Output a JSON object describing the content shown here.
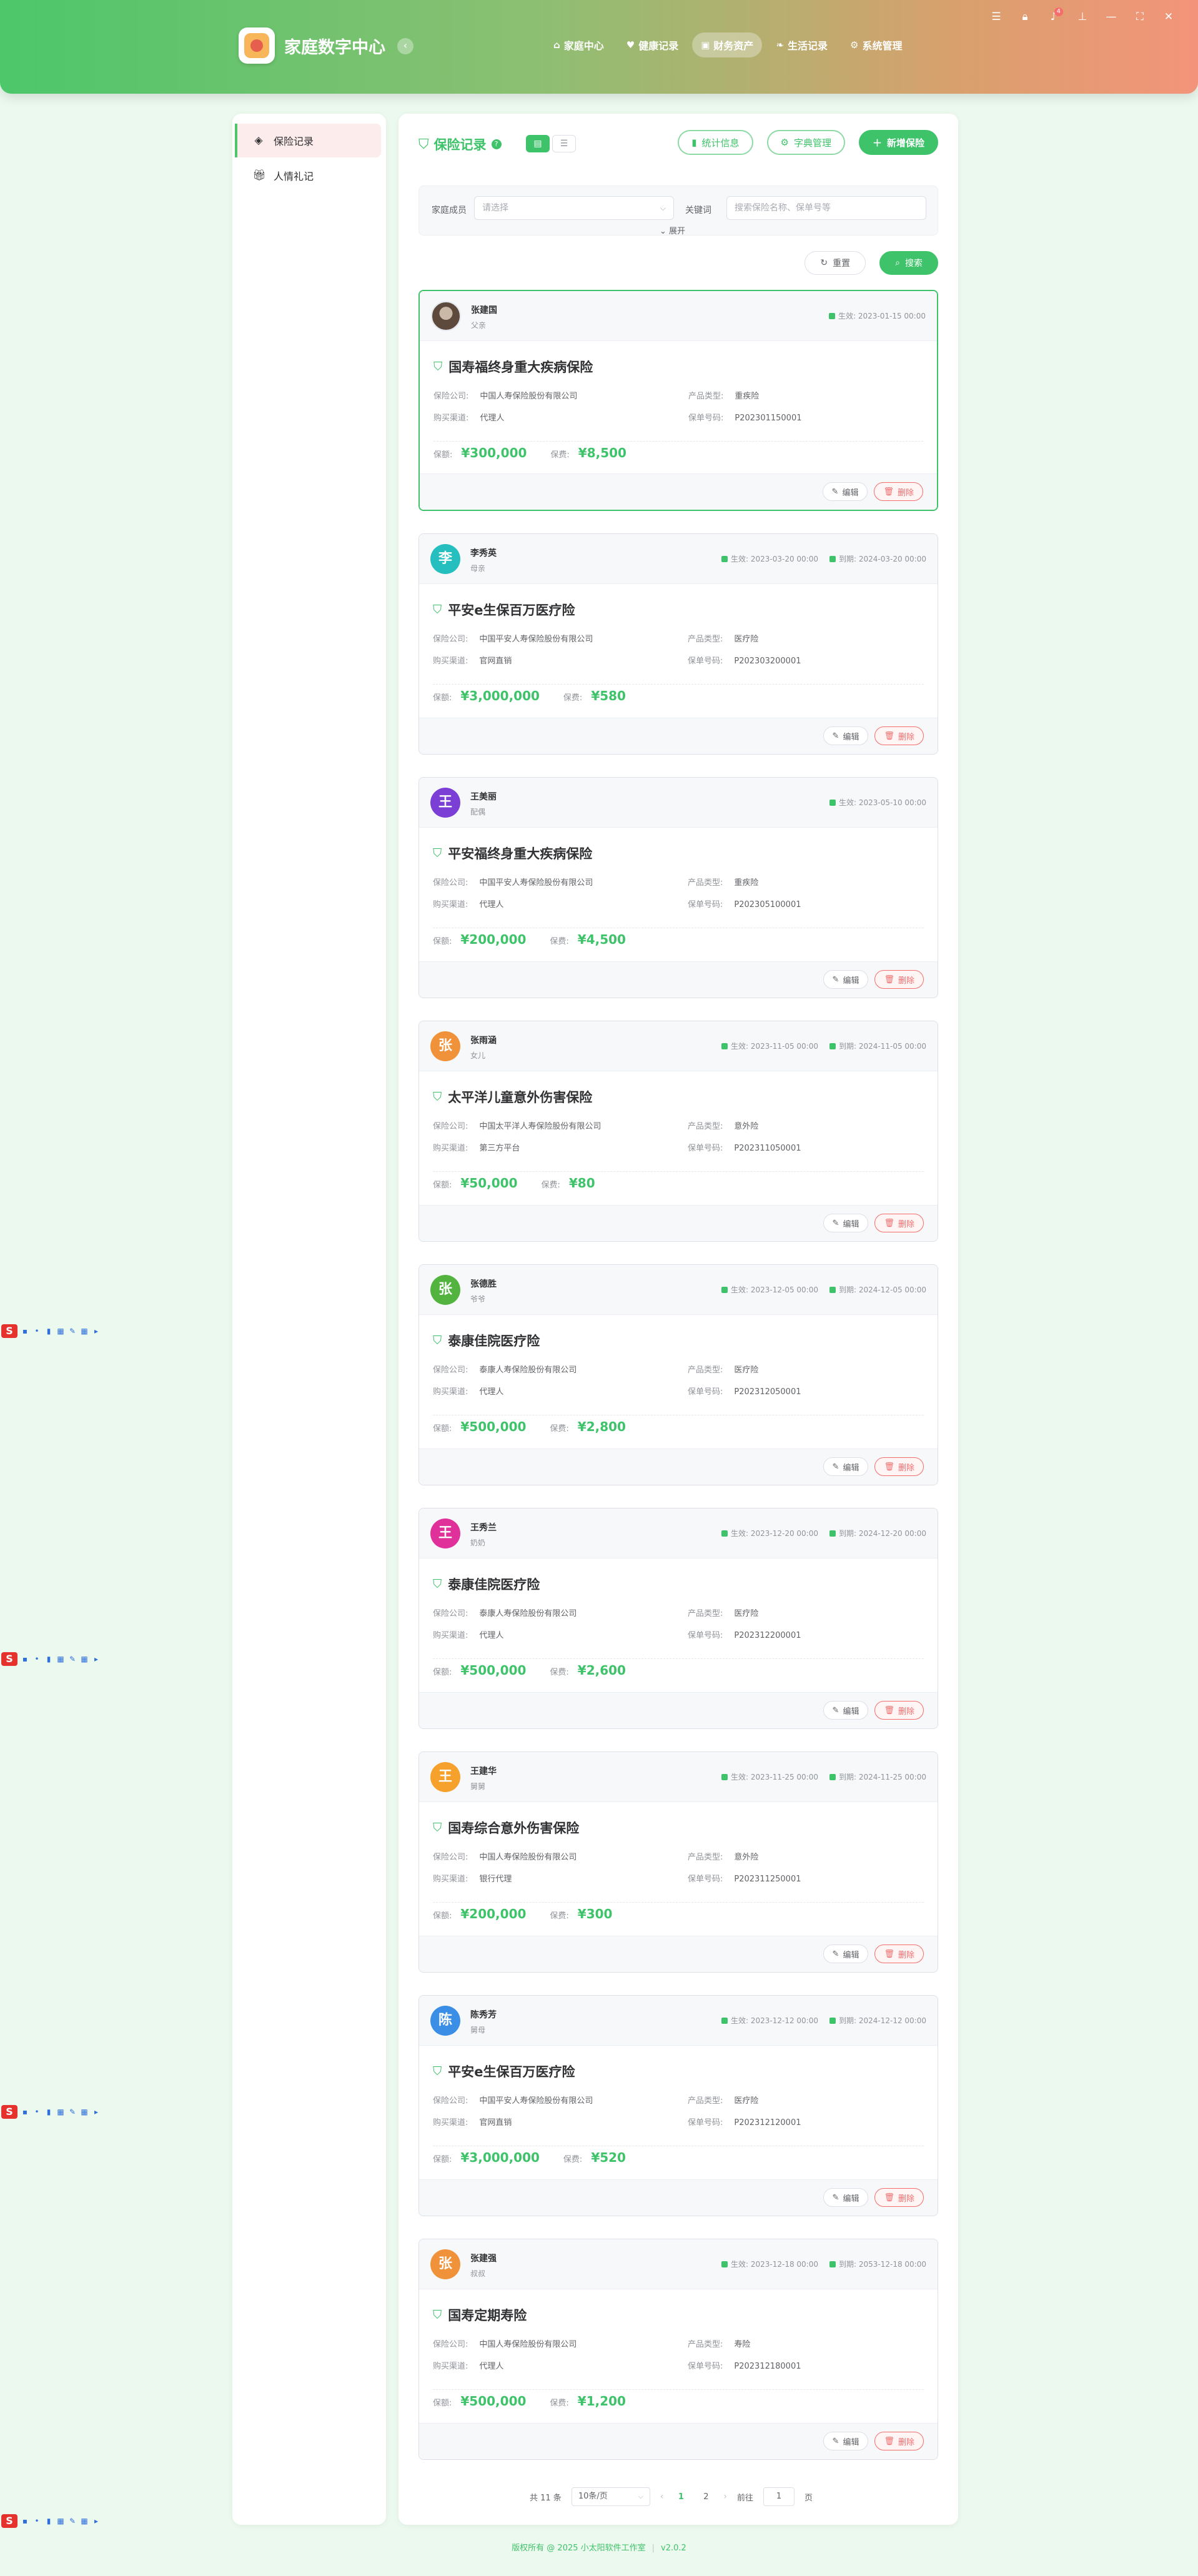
{
  "app": {
    "title": "家庭数字中心"
  },
  "nav": [
    {
      "label": "家庭中心",
      "icon": "home-icon"
    },
    {
      "label": "健康记录",
      "icon": "heart-icon"
    },
    {
      "label": "财务资产",
      "icon": "wallet-icon",
      "active": true
    },
    {
      "label": "生活记录",
      "icon": "leaf-icon"
    },
    {
      "label": "系统管理",
      "icon": "gears-icon"
    }
  ],
  "window": {
    "notification_count": "4"
  },
  "sidebar": {
    "items": [
      {
        "label": "保险记录",
        "icon": "shield-icon",
        "active": true
      },
      {
        "label": "人情礼记",
        "icon": "gift-icon"
      }
    ]
  },
  "toolbar": {
    "title": "保险记录",
    "stats_label": "统计信息",
    "dict_label": "字典管理",
    "add_label": "新增保险"
  },
  "filter": {
    "member_label": "家庭成员",
    "member_placeholder": "请选择",
    "keyword_label": "关键词",
    "keyword_placeholder": "搜索保险名称、保单号等",
    "expand_label": "展开",
    "reset_label": "重置",
    "search_label": "搜索"
  },
  "labels": {
    "company": "保险公司:",
    "type": "产品类型:",
    "channel": "购买渠道:",
    "policy": "保单号码:",
    "coverage": "保额:",
    "premium": "保费:",
    "effective": "生效:",
    "expiry": "到期:",
    "edit": "编辑",
    "delete": "删除"
  },
  "records": [
    {
      "member": "张建国",
      "relation": "父亲",
      "avatar": "",
      "avatar_color": "photo",
      "effective": "2023-01-15 00:00",
      "expiry": "",
      "product": "国寿福终身重大疾病保险",
      "company": "中国人寿保险股份有限公司",
      "type": "重疾险",
      "channel": "代理人",
      "policy": "P202301150001",
      "coverage": "¥300,000",
      "premium": "¥8,500",
      "highlight": true
    },
    {
      "member": "李秀英",
      "relation": "母亲",
      "avatar": "李",
      "avatar_color": "#26bfbf",
      "effective": "2023-03-20 00:00",
      "expiry": "2024-03-20 00:00",
      "product": "平安e生保百万医疗险",
      "company": "中国平安人寿保险股份有限公司",
      "type": "医疗险",
      "channel": "官网直销",
      "policy": "P202303200001",
      "coverage": "¥3,000,000",
      "premium": "¥580",
      "highlight": false
    },
    {
      "member": "王美丽",
      "relation": "配偶",
      "avatar": "王",
      "avatar_color": "#7b3fd6",
      "effective": "2023-05-10 00:00",
      "expiry": "",
      "product": "平安福终身重大疾病保险",
      "company": "中国平安人寿保险股份有限公司",
      "type": "重疾险",
      "channel": "代理人",
      "policy": "P202305100001",
      "coverage": "¥200,000",
      "premium": "¥4,500",
      "highlight": false
    },
    {
      "member": "张雨涵",
      "relation": "女儿",
      "avatar": "张",
      "avatar_color": "#f0923a",
      "effective": "2023-11-05 00:00",
      "expiry": "2024-11-05 00:00",
      "product": "太平洋儿童意外伤害保险",
      "company": "中国太平洋人寿保险股份有限公司",
      "type": "意外险",
      "channel": "第三方平台",
      "policy": "P202311050001",
      "coverage": "¥50,000",
      "premium": "¥80",
      "highlight": false
    },
    {
      "member": "张德胜",
      "relation": "爷爷",
      "avatar": "张",
      "avatar_color": "#52b43f",
      "effective": "2023-12-05 00:00",
      "expiry": "2024-12-05 00:00",
      "product": "泰康佳院医疗险",
      "company": "泰康人寿保险股份有限公司",
      "type": "医疗险",
      "channel": "代理人",
      "policy": "P202312050001",
      "coverage": "¥500,000",
      "premium": "¥2,800",
      "highlight": false
    },
    {
      "member": "王秀兰",
      "relation": "奶奶",
      "avatar": "王",
      "avatar_color": "#e0309a",
      "effective": "2023-12-20 00:00",
      "expiry": "2024-12-20 00:00",
      "product": "泰康佳院医疗险",
      "company": "泰康人寿保险股份有限公司",
      "type": "医疗险",
      "channel": "代理人",
      "policy": "P202312200001",
      "coverage": "¥500,000",
      "premium": "¥2,600",
      "highlight": false
    },
    {
      "member": "王建华",
      "relation": "舅舅",
      "avatar": "王",
      "avatar_color": "#f5a12b",
      "effective": "2023-11-25 00:00",
      "expiry": "2024-11-25 00:00",
      "product": "国寿综合意外伤害保险",
      "company": "中国人寿保险股份有限公司",
      "type": "意外险",
      "channel": "银行代理",
      "policy": "P202311250001",
      "coverage": "¥200,000",
      "premium": "¥300",
      "highlight": false
    },
    {
      "member": "陈秀芳",
      "relation": "舅母",
      "avatar": "陈",
      "avatar_color": "#3a8ee6",
      "effective": "2023-12-12 00:00",
      "expiry": "2024-12-12 00:00",
      "product": "平安e生保百万医疗险",
      "company": "中国平安人寿保险股份有限公司",
      "type": "医疗险",
      "channel": "官网直销",
      "policy": "P202312120001",
      "coverage": "¥3,000,000",
      "premium": "¥520",
      "highlight": false
    },
    {
      "member": "张建强",
      "relation": "叔叔",
      "avatar": "张",
      "avatar_color": "#f0923a",
      "effective": "2023-12-18 00:00",
      "expiry": "2053-12-18 00:00",
      "product": "国寿定期寿险",
      "company": "中国人寿保险股份有限公司",
      "type": "寿险",
      "channel": "代理人",
      "policy": "P202312180001",
      "coverage": "¥500,000",
      "premium": "¥1,200",
      "highlight": false
    }
  ],
  "pagination": {
    "total": "共 11 条",
    "page_size": "10条/页",
    "pages": [
      "1",
      "2"
    ],
    "current": "1",
    "goto_label": "前往",
    "goto_value": "1",
    "page_suffix": "页"
  },
  "footer": {
    "copyright": "版权所有 @ 2025 小太阳软件工作室",
    "version": "v2.0.2"
  }
}
